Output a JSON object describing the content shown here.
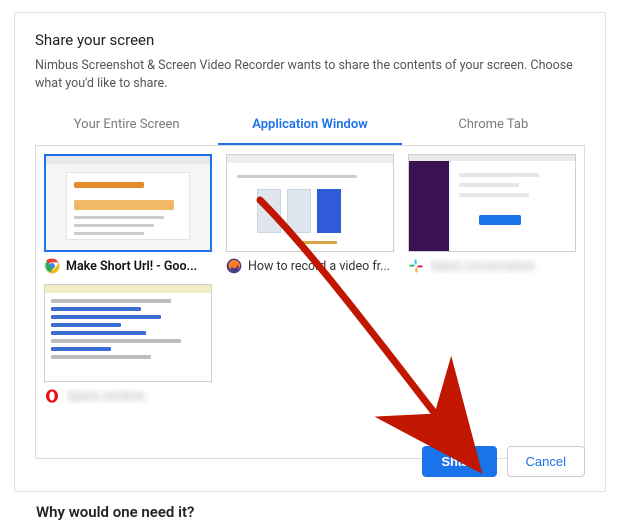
{
  "dialog": {
    "title": "Share your screen",
    "description": "Nimbus Screenshot & Screen Video Recorder wants to share the contents of your screen. Choose what you'd like to share."
  },
  "tabs": {
    "entire_screen": "Your Entire Screen",
    "application_window": "Application Window",
    "chrome_tab": "Chrome Tab",
    "active": "application_window"
  },
  "windows": [
    {
      "id": "chrome",
      "label": "Make Short Url! - Goo...",
      "icon": "chrome",
      "selected": true,
      "redacted": false
    },
    {
      "id": "firefox",
      "label": "How to record a video fr...",
      "icon": "firefox",
      "selected": false,
      "redacted": false
    },
    {
      "id": "slack",
      "label": "Slack conversation",
      "icon": "slack",
      "selected": false,
      "redacted": true
    },
    {
      "id": "opera",
      "label": "Opera window",
      "icon": "opera",
      "selected": false,
      "redacted": true
    }
  ],
  "buttons": {
    "share": "Share",
    "cancel": "Cancel"
  },
  "annotation": {
    "arrow_color": "#c11600",
    "description": "Red arrow pointing to Share button"
  },
  "below_dialog_text": "Why would one need it?"
}
